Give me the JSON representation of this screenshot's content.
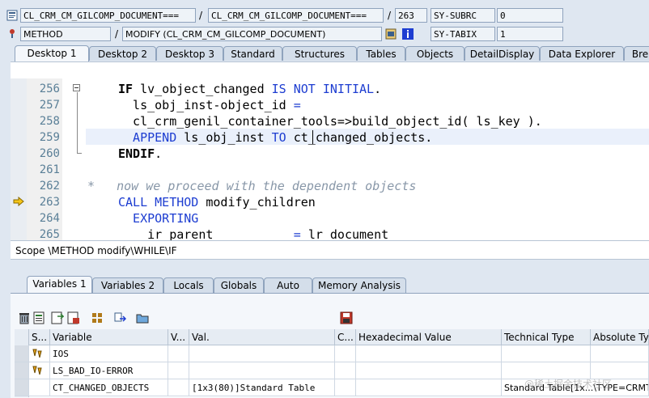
{
  "header": {
    "row1": {
      "program": "CL_CRM_CM_GILCOMP_DOCUMENT===",
      "include": "CL_CRM_CM_GILCOMP_DOCUMENT===",
      "line": "263",
      "sysvar": "SY-SUBRC",
      "sysval": "0"
    },
    "row2": {
      "type": "METHOD",
      "event": "MODIFY (CL_CRM_CM_GILCOMP_DOCUMENT)",
      "sysvar": "SY-TABIX",
      "sysval": "1"
    },
    "sep": "/"
  },
  "tabs": [
    "Desktop 1",
    "Desktop 2",
    "Desktop 3",
    "Standard",
    "Structures",
    "Tables",
    "Objects",
    "DetailDisplay",
    "Data Explorer",
    "Bre"
  ],
  "editor": {
    "lines": [
      {
        "num": "256",
        "parts": [
          {
            "t": "IF ",
            "c": "kwb"
          },
          {
            "t": "lv_object_changed ",
            "c": "id"
          },
          {
            "t": "IS NOT INITIAL",
            "c": "kw"
          },
          {
            "t": ".",
            "c": "id"
          }
        ]
      },
      {
        "num": "257",
        "parts": [
          {
            "t": "  ls_obj_inst-object_id ",
            "c": "id"
          },
          {
            "t": "=",
            "c": "kw"
          }
        ]
      },
      {
        "num": "258",
        "parts": [
          {
            "t": "  cl_crm_genil_container_tools=>build_object_id( ls_key ).",
            "c": "id"
          }
        ]
      },
      {
        "num": "259",
        "parts": [
          {
            "t": "  APPEND ",
            "c": "kw"
          },
          {
            "t": "ls_obj_inst ",
            "c": "id"
          },
          {
            "t": "TO ",
            "c": "kw"
          },
          {
            "t": "ct_changed_objects.",
            "c": "id"
          }
        ]
      },
      {
        "num": "260",
        "parts": [
          {
            "t": "ENDIF",
            "c": "kwb"
          },
          {
            "t": ".",
            "c": "id"
          }
        ]
      },
      {
        "num": "261",
        "parts": []
      },
      {
        "num": "262",
        "parts": [
          {
            "t": "*   now we proceed with the dependent objects",
            "c": "cm"
          }
        ]
      },
      {
        "num": "263",
        "parts": [
          {
            "t": "CALL METHOD ",
            "c": "kw"
          },
          {
            "t": "modify_children",
            "c": "id"
          }
        ]
      },
      {
        "num": "264",
        "parts": [
          {
            "t": "  EXPORTING",
            "c": "kw"
          }
        ]
      },
      {
        "num": "265",
        "parts": [
          {
            "t": "    ir_parent           ",
            "c": "id"
          },
          {
            "t": "= ",
            "c": "kw"
          },
          {
            "t": "lr_document",
            "c": "id"
          }
        ]
      }
    ],
    "current_line": "263"
  },
  "scope": "Scope \\METHOD modify\\WHILE\\IF",
  "var_tabs": [
    "Variables 1",
    "Variables 2",
    "Locals",
    "Globals",
    "Auto",
    "Memory Analysis"
  ],
  "table": {
    "headers": [
      "S...",
      "Variable",
      "V...",
      "Val.",
      "C...",
      "Hexadecimal Value",
      "Technical Type",
      "Absolute Typ"
    ],
    "rows": [
      {
        "variable": "IOS",
        "value": "",
        "tech": ""
      },
      {
        "variable": "LS_BAD_IO-ERROR",
        "value": "",
        "tech": ""
      },
      {
        "variable": "CT_CHANGED_OBJECTS",
        "value": "[1x3(80)]Standard Table",
        "tech": "Standard Table[1x...\\TYPE=CRMT"
      }
    ]
  },
  "watermark": "@稀土掘金技术社区",
  "colors": {
    "keyword": "#1d3dd1",
    "comment": "#8897a8",
    "line_number": "#5a7f97",
    "accent_bg": "#dfe7f1"
  }
}
